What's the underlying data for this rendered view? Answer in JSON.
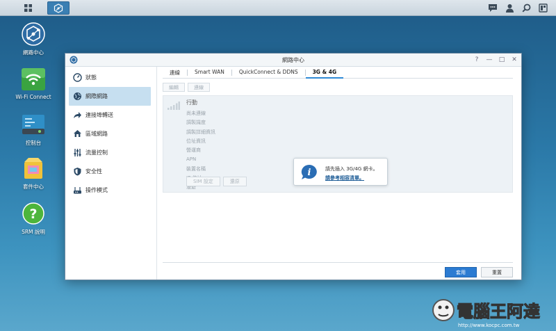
{
  "taskbar": {
    "main_menu_icon": "grid-icon",
    "active_app_icon": "network-center-icon",
    "right_icons": [
      "chat-icon",
      "user-icon",
      "search-icon",
      "widgets-icon"
    ]
  },
  "desktop": {
    "icons": [
      {
        "label": "網路中心",
        "icon": "network-center-icon"
      },
      {
        "label": "Wi-Fi Connect",
        "icon": "wifi-icon"
      },
      {
        "label": "控制台",
        "icon": "control-panel-icon"
      },
      {
        "label": "套件中心",
        "icon": "package-center-icon"
      },
      {
        "label": "SRM 說明",
        "icon": "help-icon"
      }
    ]
  },
  "window": {
    "title": "網路中心",
    "controls": [
      "?",
      "—",
      "□",
      "✕"
    ],
    "sidebar": {
      "items": [
        {
          "label": "狀態",
          "icon": "gauge-icon"
        },
        {
          "label": "網際網路",
          "icon": "globe-icon",
          "active": true
        },
        {
          "label": "連接埠轉送",
          "icon": "forward-arrow-icon"
        },
        {
          "label": "區域網路",
          "icon": "home-network-icon"
        },
        {
          "label": "流量控制",
          "icon": "sliders-icon"
        },
        {
          "label": "安全性",
          "icon": "shield-icon"
        },
        {
          "label": "操作模式",
          "icon": "router-icon"
        }
      ]
    },
    "tabs": [
      {
        "label": "連線"
      },
      {
        "label": "Smart WAN"
      },
      {
        "label": "QuickConnect & DDNS"
      },
      {
        "label": "3G & 4G",
        "active": true
      }
    ],
    "toolbar": {
      "edit": "編輯",
      "connect": "連線"
    },
    "panel": {
      "title": "行動",
      "lines": [
        "尚未連線",
        "調製識度",
        "調製詳細資訊",
        "位址資訊",
        "營運商",
        "APN",
        "裝置名稱",
        "IP 位址",
        "漫遊"
      ],
      "buttons": {
        "sim": "SIM 設定",
        "disconnect": "還原"
      }
    },
    "bubble": {
      "message": "請先插入 3G/4G 網卡。",
      "link": "請參考相容清單。"
    },
    "footer": {
      "apply": "套用",
      "reset": "重置"
    }
  },
  "watermark": {
    "text": "電腦王阿達",
    "url": "http://www.kocpc.com.tw"
  },
  "colors": {
    "accent": "#2b7bd2",
    "active_sidebar": "#c6dff0",
    "desktop_top": "#1e5a86",
    "desktop_bottom": "#5aa7cc"
  }
}
